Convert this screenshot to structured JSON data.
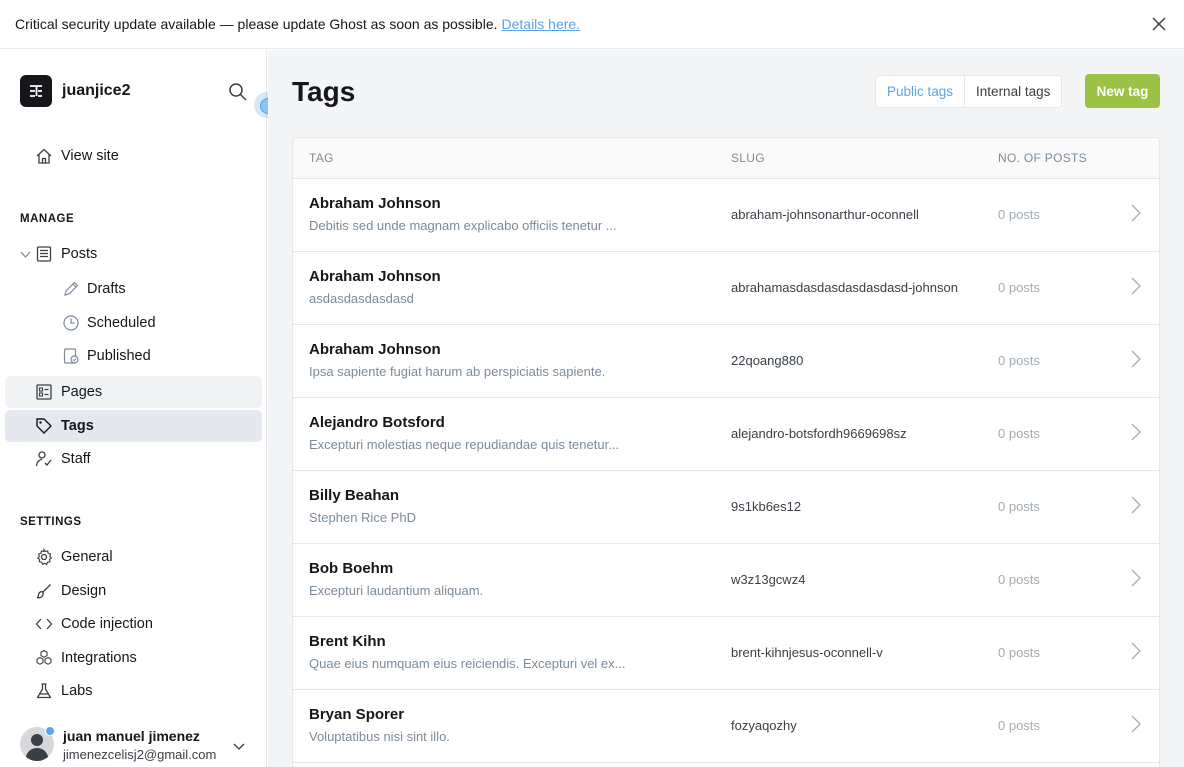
{
  "alert": {
    "message": "Critical security update available — please update Ghost as soon as possible.",
    "link": "Details here."
  },
  "sidebar": {
    "site_name": "juanjice2",
    "view_site": "View site",
    "manage_title": "MANAGE",
    "posts": "Posts",
    "drafts": "Drafts",
    "scheduled": "Scheduled",
    "published": "Published",
    "pages": "Pages",
    "tags": "Tags",
    "staff": "Staff",
    "settings_title": "SETTINGS",
    "general": "General",
    "design": "Design",
    "code_injection": "Code injection",
    "integrations": "Integrations",
    "labs": "Labs"
  },
  "user": {
    "name": "juan manuel jimenez",
    "email": "jimenezcelisj2@gmail.com"
  },
  "header": {
    "title": "Tags",
    "public_tags": "Public tags",
    "internal_tags": "Internal tags",
    "new_tag": "New tag"
  },
  "table": {
    "col_tag": "TAG",
    "col_slug": "SLUG",
    "col_posts": "NO. OF POSTS",
    "rows": [
      {
        "name": "Abraham Johnson",
        "desc": "Debitis sed unde magnam explicabo officiis tenetur ...",
        "slug": "abraham-johnsonarthur-oconnell",
        "posts": "0 posts"
      },
      {
        "name": "Abraham Johnson",
        "desc": "asdasdasdasdasd",
        "slug": "abrahamasdasdasdasdasdasd-johnson",
        "posts": "0 posts"
      },
      {
        "name": "Abraham Johnson",
        "desc": "Ipsa sapiente fugiat harum ab perspiciatis sapiente.",
        "slug": "22qoang880",
        "posts": "0 posts"
      },
      {
        "name": "Alejandro Botsford",
        "desc": "Excepturi molestias neque repudiandae quis tenetur...",
        "slug": "alejandro-botsfordh9669698sz",
        "posts": "0 posts"
      },
      {
        "name": "Billy Beahan",
        "desc": "Stephen Rice PhD",
        "slug": "9s1kb6es12",
        "posts": "0 posts"
      },
      {
        "name": "Bob Boehm",
        "desc": "Excepturi laudantium aliquam.",
        "slug": "w3z13gcwz4",
        "posts": "0 posts"
      },
      {
        "name": "Brent Kihn",
        "desc": "Quae eius numquam eius reiciendis. Excepturi vel ex...",
        "slug": "brent-kihnjesus-oconnell-v",
        "posts": "0 posts"
      },
      {
        "name": "Bryan Sporer",
        "desc": "Voluptatibus nisi sint illo.",
        "slug": "fozyaqozhy",
        "posts": "0 posts"
      }
    ]
  }
}
